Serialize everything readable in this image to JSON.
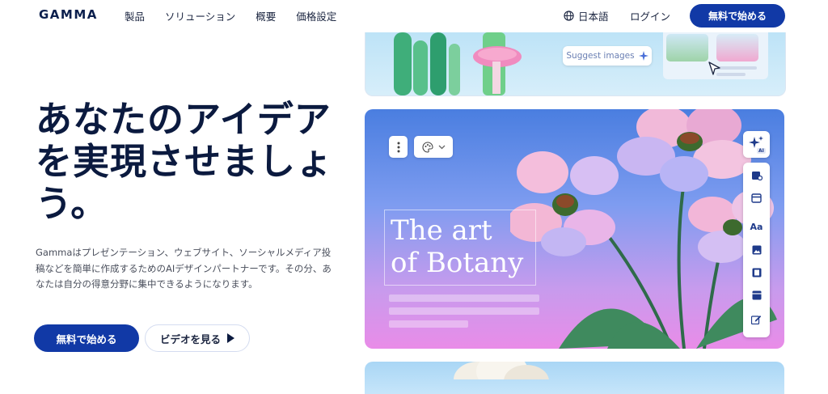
{
  "header": {
    "logo": "GAMMA",
    "nav": [
      "製品",
      "ソリューション",
      "概要",
      "価格設定"
    ],
    "language": "日本語",
    "login": "ログイン",
    "cta": "無料で始める"
  },
  "hero": {
    "title": "あなたのアイデアを実現させましょう。",
    "description": "Gammaはプレゼンテーション、ウェブサイト、ソーシャルメディア投稿などを簡単に作成するためのAIデザインパートナーです。その分、あなたは自分の得意分野に集中できるようになります。",
    "primary_button": "無料で始める",
    "secondary_button": "ビデオを見る"
  },
  "preview": {
    "suggest_images": "Suggest images",
    "art_title_line1": "The art",
    "art_title_line2": "of Botany",
    "ai_badge": "AI",
    "toolbar_text_tool": "Aa"
  },
  "colors": {
    "brand": "#1139a6",
    "title_text": "#0b1a3f",
    "body_text": "#4a4f5c"
  },
  "icons": [
    "globe-icon",
    "play-icon",
    "sparkle-icon",
    "more-vertical-icon",
    "palette-icon",
    "chevron-down-icon",
    "ai-sparkle-icon",
    "layout-icon",
    "card-icon",
    "text-icon",
    "image-icon",
    "video-icon",
    "block-icon",
    "edit-icon",
    "cursor-icon",
    "flower-image",
    "mushroom-image",
    "cloud-image"
  ]
}
